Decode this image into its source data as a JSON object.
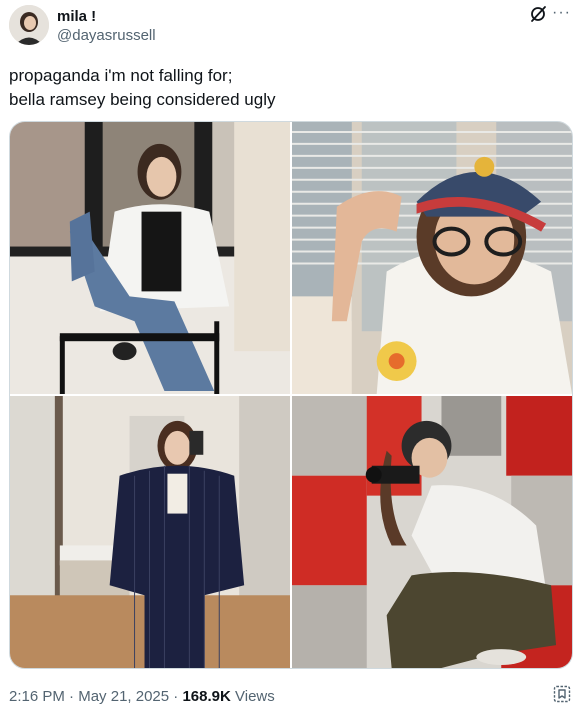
{
  "author": {
    "display_name": "mila !",
    "handle": "@dayasrussell"
  },
  "tweet": {
    "text": "propaganda i'm not falling for;\nbella ramsey being considered ugly"
  },
  "media": {
    "photos": [
      {
        "icon": "photo-image"
      },
      {
        "icon": "photo-image"
      },
      {
        "icon": "photo-image"
      },
      {
        "icon": "photo-image"
      }
    ]
  },
  "meta": {
    "time": "2:16 PM",
    "separator": "·",
    "date": "May 21, 2025",
    "views_count": "168.9K",
    "views_label": "Views"
  },
  "colors": {
    "text": "#0f1419",
    "secondary": "#536471",
    "border": "#cfd9de"
  },
  "icons": {
    "grok": "grok-icon",
    "more": "more-icon",
    "bookmark_corner": "bookmark-icon"
  }
}
